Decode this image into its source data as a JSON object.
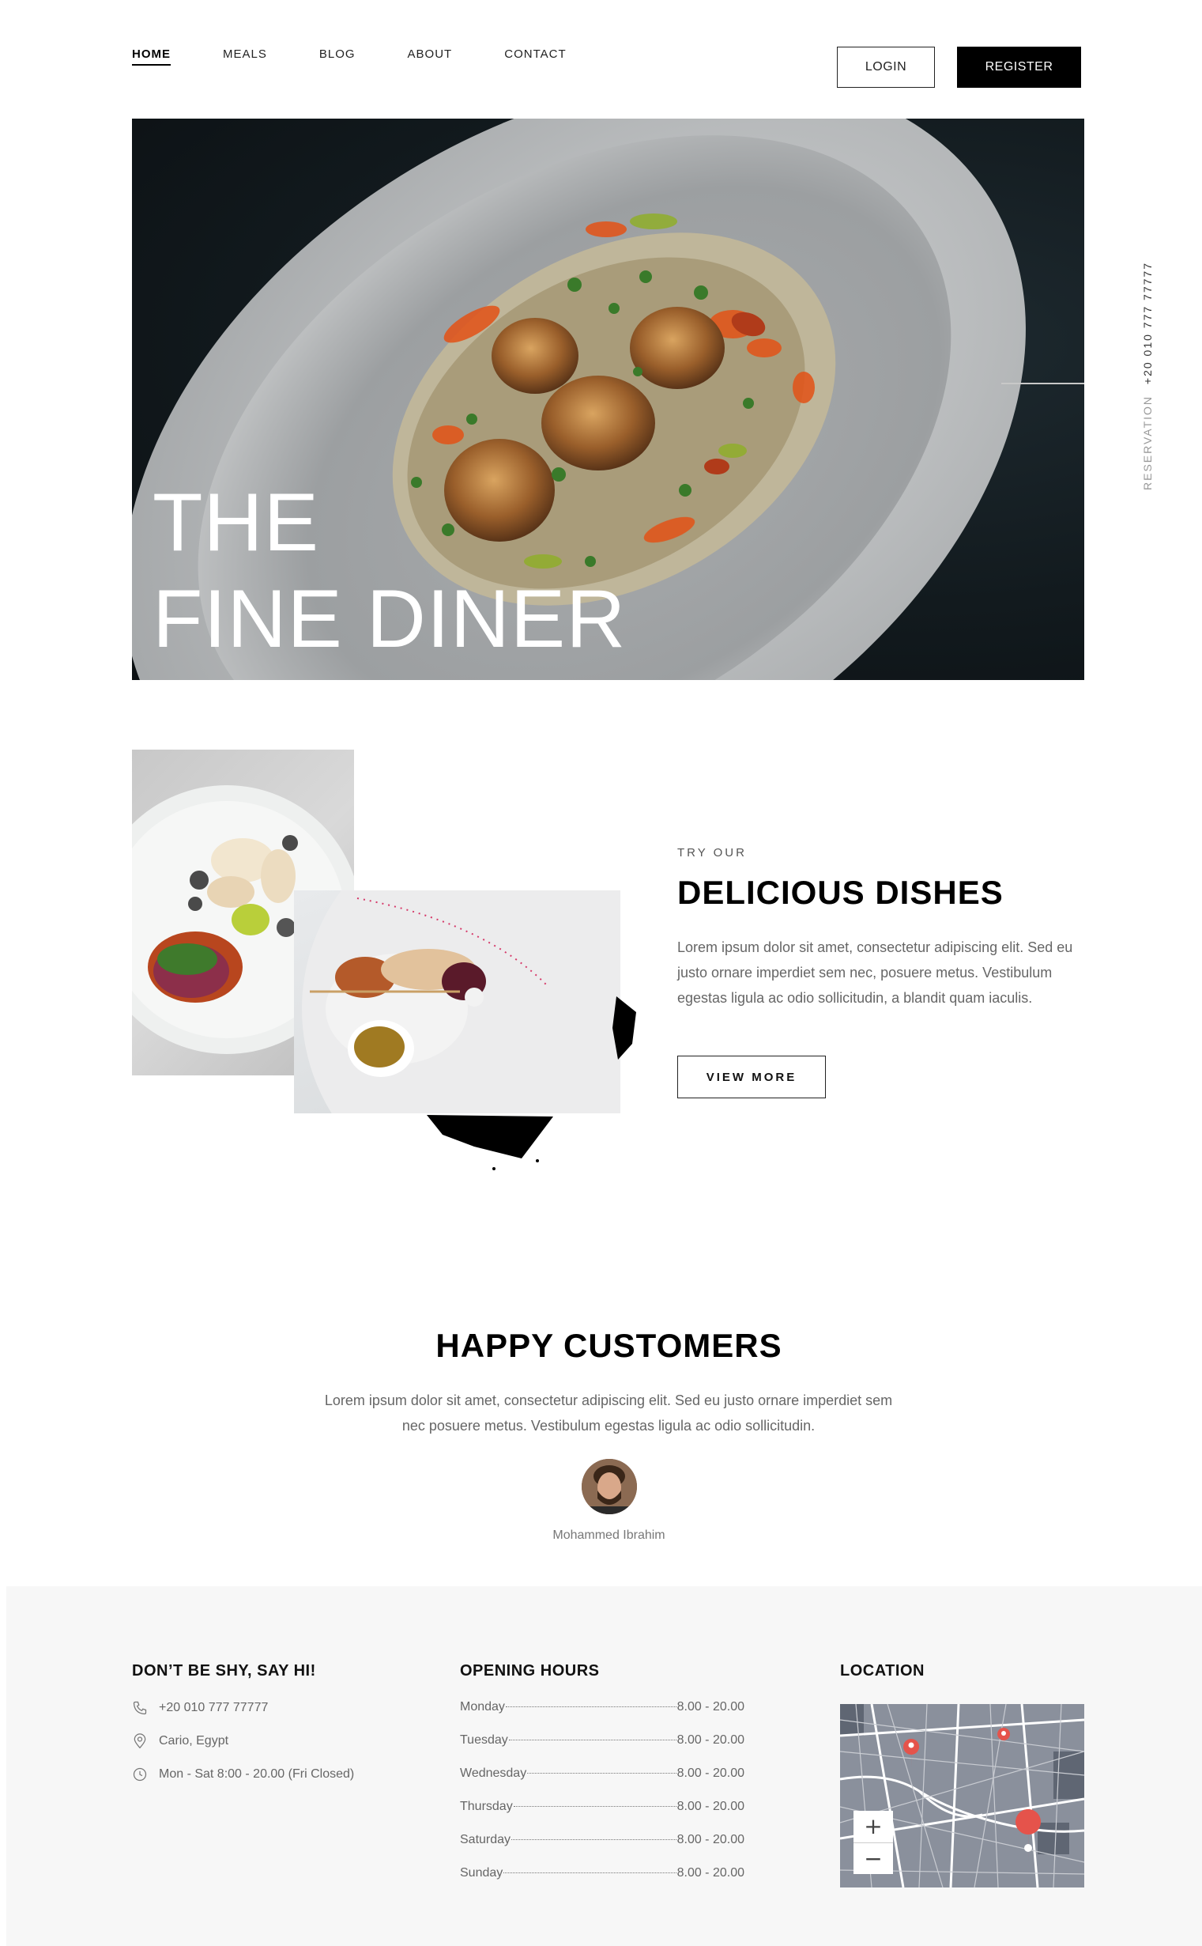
{
  "nav": {
    "items": [
      "HOME",
      "MEALS",
      "BLOG",
      "ABOUT",
      "CONTACT"
    ],
    "active": "HOME",
    "login": "LOGIN",
    "register": "REGISTER"
  },
  "hero": {
    "line1": "THE",
    "line2": "FINE DINER"
  },
  "reservation": {
    "label": "RESERVATION",
    "phone": "+20 010 777 77777"
  },
  "dishes": {
    "kicker": "TRY OUR",
    "title": "DELICIOUS DISHES",
    "text": "Lorem ipsum dolor sit amet, consectetur adipiscing elit. Sed eu justo ornare imperdiet sem nec, posuere metus. Vestibulum egestas ligula ac odio sollicitudin, a blandit quam iaculis.",
    "button": "VIEW MORE"
  },
  "customers": {
    "title": "HAPPY CUSTOMERS",
    "text": "Lorem ipsum dolor sit amet, consectetur adipiscing elit. Sed eu justo ornare imperdiet sem nec posuere metus. Vestibulum egestas ligula ac odio sollicitudin.",
    "name": "Mohammed Ibrahim"
  },
  "footer": {
    "contact": {
      "title": "DON’T BE SHY, SAY HI!",
      "phone": "+20 010 777 77777",
      "address": "Cario, Egypt",
      "hours": "Mon - Sat 8:00 - 20.00 (Fri Closed)"
    },
    "opening": {
      "title": "OPENING HOURS",
      "rows": [
        {
          "day": "Monday",
          "time": "8.00 - 20.00"
        },
        {
          "day": "Tuesday",
          "time": "8.00 - 20.00"
        },
        {
          "day": "Wednesday",
          "time": "8.00 - 20.00"
        },
        {
          "day": "Thursday",
          "time": "8.00 - 20.00"
        },
        {
          "day": "Saturday",
          "time": "8.00 - 20.00"
        },
        {
          "day": "Sunday",
          "time": "8.00 - 20.00"
        }
      ]
    },
    "location": {
      "title": "LOCATION",
      "zoom_in": "+",
      "zoom_out": "−"
    }
  },
  "colors": {
    "accent": "#000000",
    "map_pin": "#e5534b",
    "footer_bg": "#f7f7f7"
  }
}
